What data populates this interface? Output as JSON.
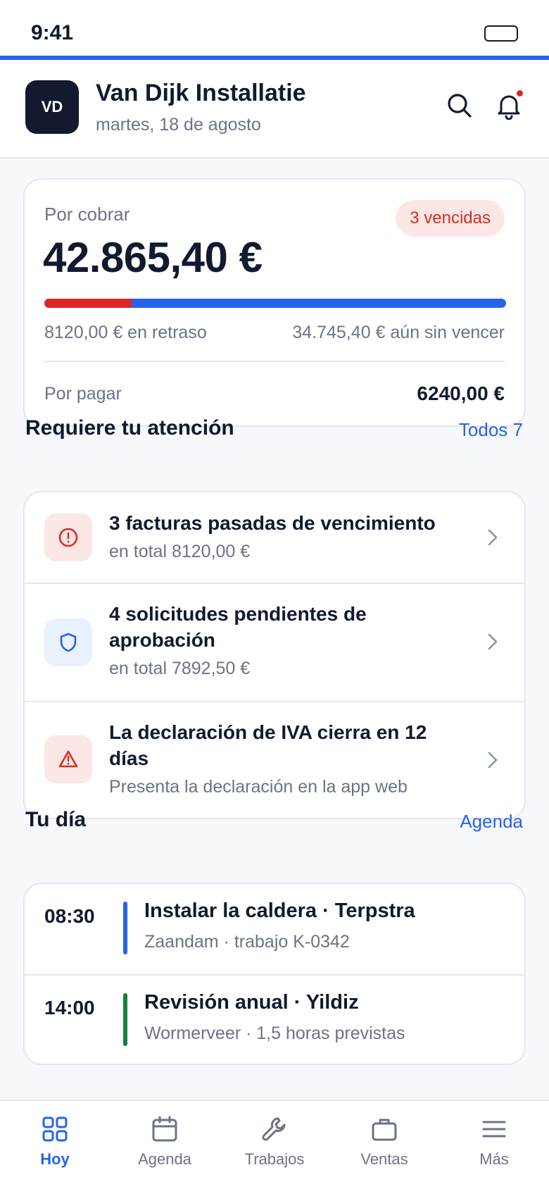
{
  "status_bar": {
    "time": "9:41"
  },
  "header": {
    "avatar_initials": "VD",
    "company_name": "Van Dijk Installatie",
    "date": "martes, 18 de agosto",
    "has_notification": true
  },
  "balance": {
    "receivable_label": "Por cobrar",
    "receivable_amount": "42.865,40 €",
    "overdue_badge": "3 vencidas",
    "overdue_fraction": 0.189,
    "overdue_text": "8120,00 € en retraso",
    "not_due_text": "34.745,40 € aún sin vencer",
    "payable_label": "Por pagar",
    "payable_amount": "6240,00 €"
  },
  "attention": {
    "title": "Requiere tu atención",
    "link": "Todos 7",
    "items": [
      {
        "icon": "alert-circle-icon",
        "title": "3 facturas pasadas de vencimiento",
        "subtitle": "en total 8120,00 €"
      },
      {
        "icon": "shield-icon",
        "title": "4 solicitudes pendientes de aprobación",
        "subtitle": "en total 7892,50 €"
      },
      {
        "icon": "warning-triangle-icon",
        "title": "La declaración de IVA cierra en 12 días",
        "subtitle": "Presenta la declaración en la app web"
      }
    ]
  },
  "day": {
    "title": "Tu día",
    "link": "Agenda",
    "items": [
      {
        "time": "08:30",
        "title": "Instalar la caldera · Terpstra",
        "subtitle": "Zaandam · trabajo K-0342",
        "color": "#2563eb"
      },
      {
        "time": "14:00",
        "title": "Revisión anual · Yildiz",
        "subtitle": "Wormerveer · 1,5 horas previstas",
        "color": "#16803c"
      }
    ]
  },
  "nav": {
    "items": [
      {
        "label": "Hoy",
        "icon": "grid-icon",
        "active": true
      },
      {
        "label": "Agenda",
        "icon": "calendar-icon",
        "active": false
      },
      {
        "label": "Trabajos",
        "icon": "wrench-icon",
        "active": false
      },
      {
        "label": "Ventas",
        "icon": "briefcase-icon",
        "active": false
      },
      {
        "label": "Más",
        "icon": "menu-icon",
        "active": false
      }
    ]
  },
  "colors": {
    "accent": "#2563eb",
    "danger": "#dc2626",
    "success": "#16803c",
    "text": "#111a2e",
    "muted": "#6b7385"
  }
}
